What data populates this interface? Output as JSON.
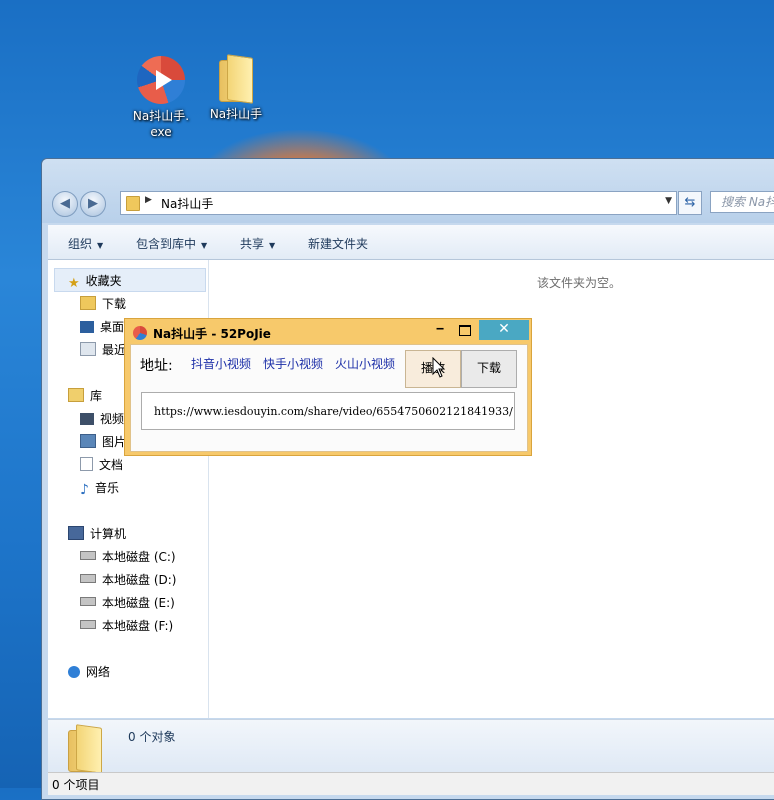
{
  "desktop": {
    "icons": [
      {
        "label": "Na抖山手.\nexe",
        "icon": "app-disc-icon"
      },
      {
        "label": "Na抖山手",
        "icon": "folder-icon"
      }
    ]
  },
  "explorer": {
    "address": {
      "path": "Na抖山手"
    },
    "search": {
      "placeholder": "搜索 Na抖"
    },
    "toolbar": {
      "organize": "组织",
      "include_library": "包含到库中",
      "share": "共享",
      "new_folder": "新建文件夹"
    },
    "nav": {
      "favorites": "收藏夹",
      "downloads": "下载",
      "desktop": "桌面",
      "recent": "最近",
      "libraries": "库",
      "videos": "视频",
      "pictures": "图片",
      "documents": "文档",
      "music": "音乐",
      "computer": "计算机",
      "drives": [
        "本地磁盘 (C:)",
        "本地磁盘 (D:)",
        "本地磁盘 (E:)",
        "本地磁盘 (F:)"
      ],
      "network": "网络"
    },
    "empty_message": "该文件夹为空。",
    "details_count": "0 个对象",
    "status": "0 个项目"
  },
  "dialog": {
    "title": "Na抖山手 - 52PoJie",
    "close_glyph": "✕",
    "minimize_glyph": "‒",
    "address_label": "地址:",
    "links": [
      "抖音小视频",
      "快手小视频",
      "火山小视频"
    ],
    "play_label": "播放",
    "download_label": "下载",
    "url_value": "https://www.iesdouyin.com/share/video/6554750602121841933/",
    "colors": {
      "frame": "#f7c96b",
      "close": "#4aa8c3",
      "link": "#1c2fa8"
    }
  }
}
